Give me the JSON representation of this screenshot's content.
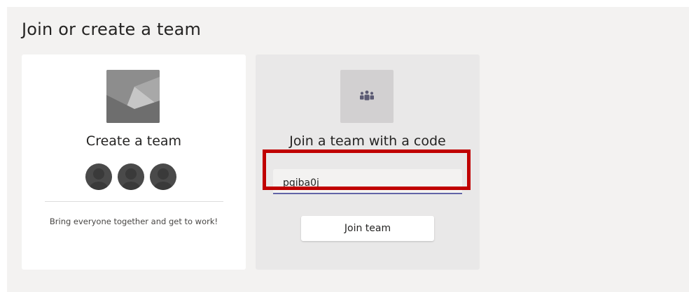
{
  "page": {
    "title": "Join or create a team"
  },
  "create_card": {
    "heading": "Create a team",
    "description": "Bring everyone together and get to work!",
    "icon": "image-placeholder-icon",
    "avatar_icons": [
      "person-avatar-icon",
      "person-avatar-icon",
      "person-avatar-icon"
    ]
  },
  "join_card": {
    "heading": "Join a team with a code",
    "icon": "teams-people-icon",
    "code_value": "pqiba0j",
    "button_label": "Join team"
  },
  "colors": {
    "accent_underline": "#6264a7",
    "highlight_border": "#c00000",
    "panel_background": "#f3f2f1"
  }
}
